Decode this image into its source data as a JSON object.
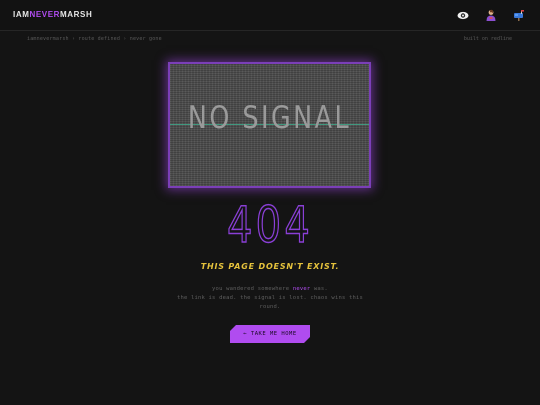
{
  "header": {
    "logo_prefix": "IAM",
    "logo_accent": "NEVER",
    "logo_suffix": "MARSH",
    "icons": [
      "eye-icon",
      "person-icon",
      "mailbox-icon"
    ]
  },
  "breadcrumb": "iamnevermarsh › route defined › never gone",
  "built_label": "built on redline",
  "tv": {
    "text": "NO SIGNAL"
  },
  "error": {
    "code": "404",
    "headline": "THIS PAGE DOESN'T EXIST.",
    "line1_prefix": "you wandered somewhere",
    "line1_highlight": "never",
    "line1_suffix": "was.",
    "line2": "the link is dead. the signal is lost. chaos wins this",
    "line3": "round."
  },
  "button": {
    "label": "← TAKE ME HOME"
  },
  "colors": {
    "background": "#141414",
    "accent": "#b04cf0",
    "headline": "#e6c33c"
  }
}
